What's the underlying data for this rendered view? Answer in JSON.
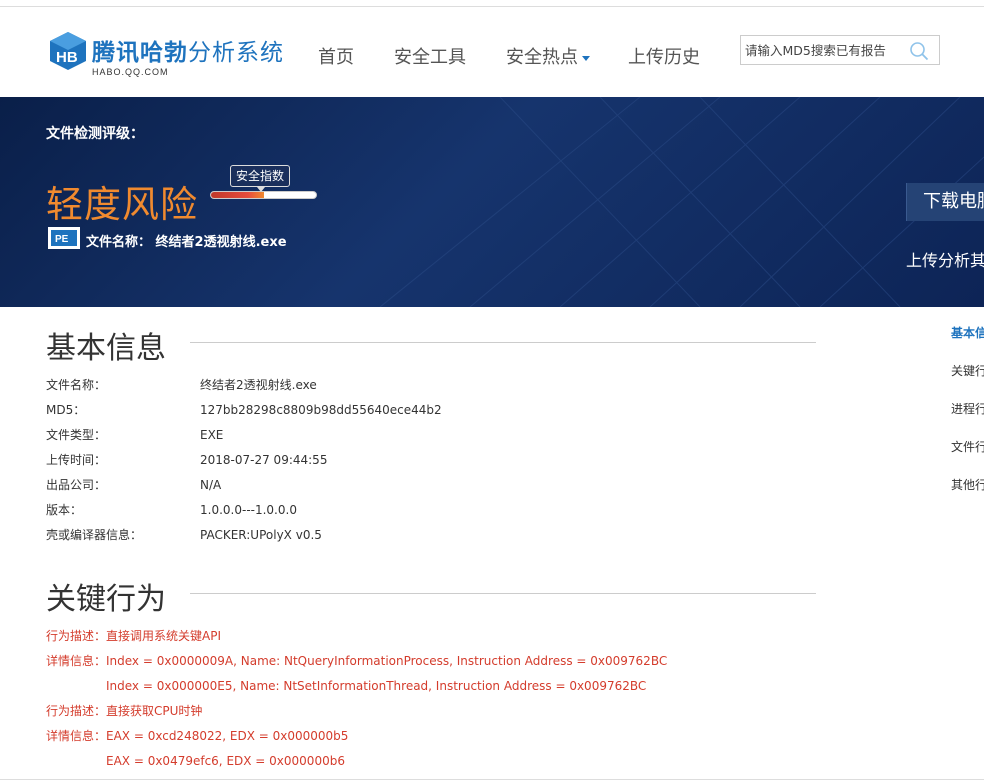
{
  "header": {
    "logo_cn": "腾讯哈勃",
    "logo_cn_suffix": "分析系统",
    "logo_en": "HABO.QQ.COM",
    "nav": [
      {
        "label": "首页"
      },
      {
        "label": "安全工具"
      },
      {
        "label": "安全热点"
      },
      {
        "label": "上传历史"
      }
    ],
    "search_placeholder": "请输入MD5搜索已有报告",
    "colors": {
      "brand": "#1e73be",
      "banner": "#0e2552",
      "risk": "#f08a2f",
      "alert": "#d43c2c"
    }
  },
  "banner": {
    "label": "文件检测评级：",
    "risk_level": "轻度风险",
    "index_tag": "安全指数",
    "index_fill_fraction": 0.5,
    "file_icon_text": "PE",
    "file_name_label": "文件名称：",
    "file_name": "终结者2透视射线.exe",
    "download_button": "下载电脑",
    "upload_text": "上传分析其"
  },
  "basic_info": {
    "title": "基本信息",
    "rows": [
      {
        "key": "文件名称：",
        "value": "终结者2透视射线.exe"
      },
      {
        "key": "MD5：",
        "value": "127bb28298c8809b98dd55640ece44b2"
      },
      {
        "key": "文件类型：",
        "value": "EXE"
      },
      {
        "key": "上传时间：",
        "value": "2018-07-27 09:44:55"
      },
      {
        "key": "出品公司：",
        "value": "N/A"
      },
      {
        "key": "版本：",
        "value": "1.0.0.0---1.0.0.0"
      },
      {
        "key": "壳或编译器信息：",
        "value": "PACKER:UPolyX v0.5"
      }
    ]
  },
  "key_behavior": {
    "title": "关键行为",
    "lines": [
      {
        "label": "行为描述：",
        "text": "直接调用系统关键API"
      },
      {
        "label": "详情信息：",
        "text": "Index = 0x0000009A, Name: NtQueryInformationProcess, Instruction Address = 0x009762BC"
      },
      {
        "label": "",
        "text": "Index = 0x000000E5, Name: NtSetInformationThread, Instruction Address = 0x009762BC"
      },
      {
        "label": "行为描述：",
        "text": "直接获取CPU时钟"
      },
      {
        "label": "详情信息：",
        "text": "EAX = 0xcd248022, EDX = 0x000000b5"
      },
      {
        "label": "",
        "text": "EAX = 0x0479efc6, EDX = 0x000000b6"
      }
    ]
  },
  "side_nav": [
    {
      "label": "基本信"
    },
    {
      "label": "关键行"
    },
    {
      "label": "进程行"
    },
    {
      "label": "文件行"
    },
    {
      "label": "其他行"
    }
  ]
}
